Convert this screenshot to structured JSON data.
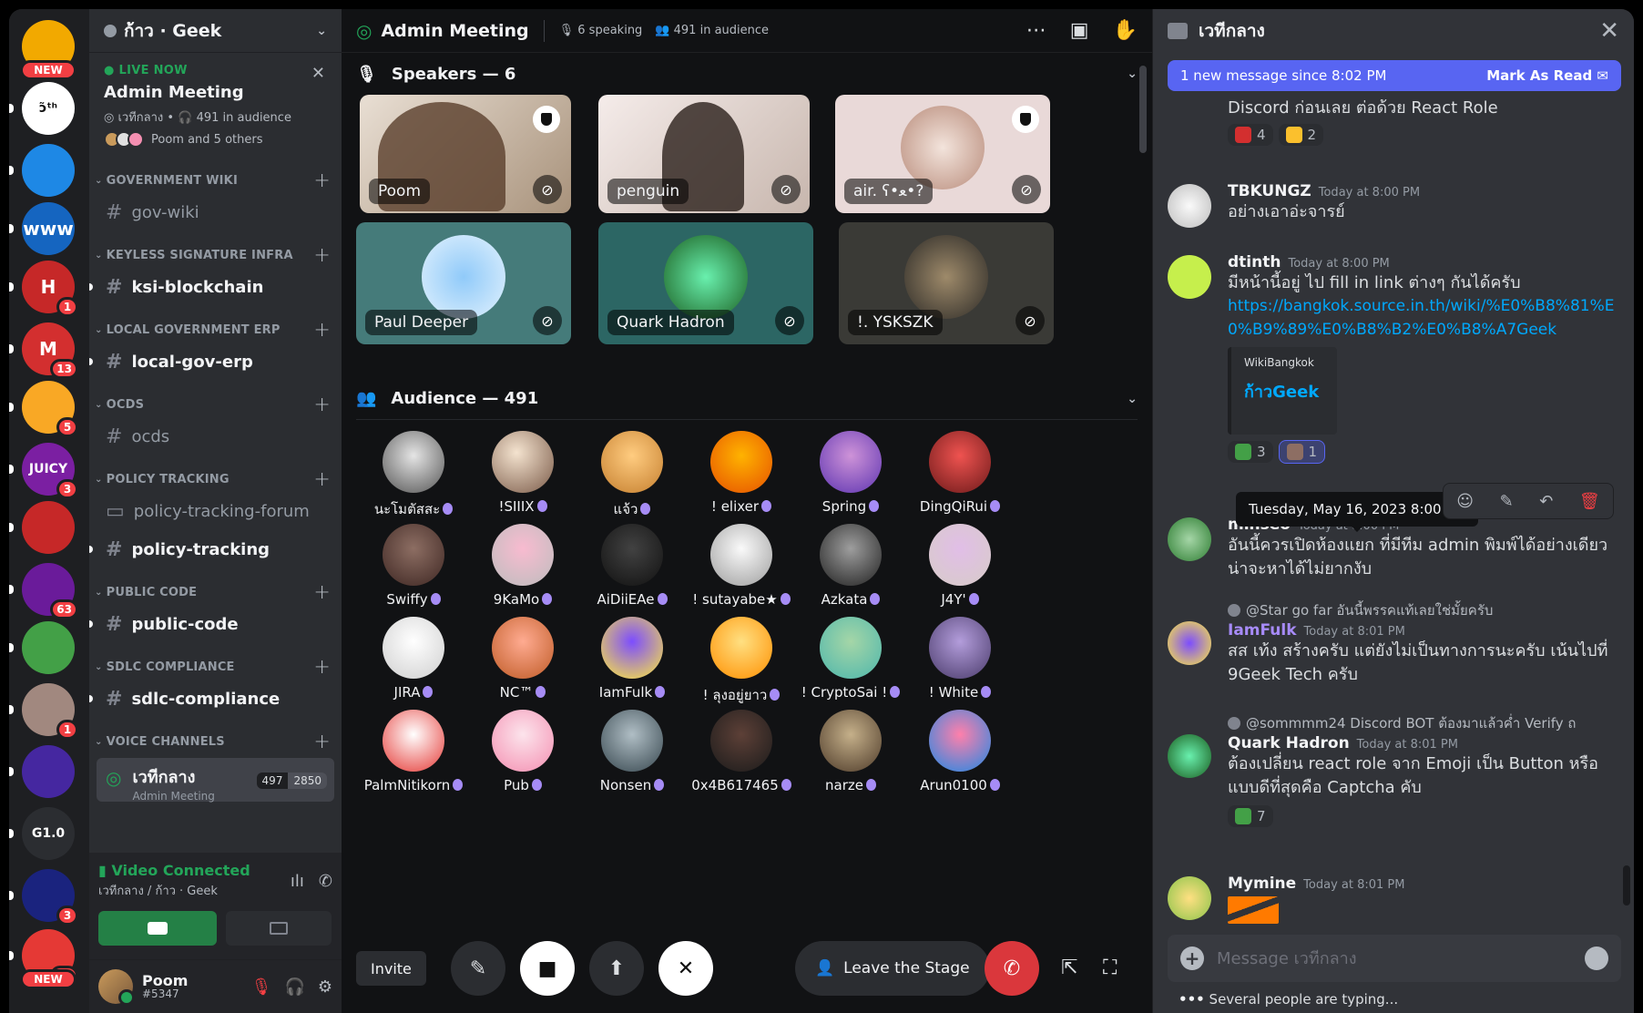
{
  "server": {
    "name": "ก้าว · Geek"
  },
  "live": {
    "label": "LIVE NOW",
    "title": "Admin Meeting",
    "channel": "เวทีกลาง",
    "audience": "491 in audience",
    "speakers": "Poom and 5 others"
  },
  "rail": {
    "new_label": "NEW",
    "items": [
      {
        "label": "",
        "badge": "",
        "new": true,
        "color": "#f2a900"
      },
      {
        "label": "ɔ̃ᵗʰ",
        "badge": "",
        "new": false,
        "color": "#ffffff"
      },
      {
        "label": "",
        "badge": "",
        "new": false,
        "color": "#1e88e5"
      },
      {
        "label": "www",
        "badge": "",
        "new": false,
        "color": "#1565c0"
      },
      {
        "label": "H",
        "badge": "1",
        "new": false,
        "color": "#c62828"
      },
      {
        "label": "M",
        "badge": "13",
        "new": false,
        "color": "#d32f2f"
      },
      {
        "label": "",
        "badge": "5",
        "new": false,
        "color": "#f9a825"
      },
      {
        "label": "JUICY",
        "badge": "3",
        "new": false,
        "color": "#7b1fa2"
      },
      {
        "label": "",
        "badge": "",
        "new": false,
        "color": "#c62828"
      },
      {
        "label": "",
        "badge": "63",
        "new": false,
        "color": "#6a1b9a"
      },
      {
        "label": "",
        "badge": "",
        "new": false,
        "color": "#43a047"
      },
      {
        "label": "",
        "badge": "1",
        "new": false,
        "color": "#a1887f"
      },
      {
        "label": "",
        "badge": "",
        "new": false,
        "color": "#4527a0"
      },
      {
        "label": "G1.0",
        "badge": "",
        "new": false,
        "color": "#2b2d31"
      },
      {
        "label": "",
        "badge": "3",
        "new": false,
        "color": "#1a237e"
      },
      {
        "label": "",
        "badge": "10",
        "new": true,
        "color": "#e53935"
      }
    ]
  },
  "sidebar": {
    "categories": [
      {
        "name": "GOVERNMENT WIKI",
        "channels": [
          {
            "name": "gov-wiki",
            "unread": false,
            "type": "text"
          }
        ]
      },
      {
        "name": "KEYLESS SIGNATURE INFRA",
        "channels": [
          {
            "name": "ksi-blockchain",
            "unread": true,
            "type": "text"
          }
        ]
      },
      {
        "name": "LOCAL GOVERNMENT ERP",
        "channels": [
          {
            "name": "local-gov-erp",
            "unread": true,
            "type": "text"
          }
        ]
      },
      {
        "name": "OCDS",
        "channels": [
          {
            "name": "ocds",
            "unread": false,
            "type": "text"
          }
        ]
      },
      {
        "name": "POLICY TRACKING",
        "channels": [
          {
            "name": "policy-tracking-forum",
            "unread": false,
            "type": "forum"
          },
          {
            "name": "policy-tracking",
            "unread": true,
            "type": "text"
          }
        ]
      },
      {
        "name": "PUBLIC CODE",
        "channels": [
          {
            "name": "public-code",
            "unread": true,
            "type": "text"
          }
        ]
      },
      {
        "name": "SDLC COMPLIANCE",
        "channels": [
          {
            "name": "sdlc-compliance",
            "unread": true,
            "type": "text"
          }
        ]
      },
      {
        "name": "VOICE CHANNELS",
        "channels": []
      }
    ],
    "voice_channel": {
      "name": "เวทีกลาง",
      "sub": "Admin Meeting",
      "count_a": "497",
      "count_b": "2850"
    }
  },
  "voice": {
    "status": "Video Connected",
    "path": "เวทีกลาง / ก้าว · Geek"
  },
  "user": {
    "name": "Poom",
    "tag": "#5347"
  },
  "stage": {
    "title": "Admin Meeting",
    "speaking": "6 speaking",
    "audience": "491 in audience",
    "speakers_header": "Speakers — 6",
    "audience_header": "Audience — 491",
    "speakers": [
      {
        "name": "Poom",
        "mod": true
      },
      {
        "name": "penguin",
        "mod": false
      },
      {
        "name": "air. ʕ•ﻌ•?",
        "mod": true
      },
      {
        "name": "Paul Deeper",
        "mod": false
      },
      {
        "name": "Quark Hadron",
        "mod": false
      },
      {
        "name": "!. YSKSZK",
        "mod": false
      }
    ],
    "audience_members": [
      {
        "name": "นะโมตัสสะ",
        "c": "g2"
      },
      {
        "name": "!SIIIX",
        "c": "g1"
      },
      {
        "name": "แจ้ว",
        "c": "g3"
      },
      {
        "name": "! elixer",
        "c": "g4"
      },
      {
        "name": "Spring",
        "c": "g5"
      },
      {
        "name": "DingQiRui",
        "c": "g6"
      },
      {
        "name": "Swiffy",
        "c": "g7"
      },
      {
        "name": "9KaMo",
        "c": "g8"
      },
      {
        "name": "AiDiiEAe",
        "c": "g9"
      },
      {
        "name": "! sutayabe★",
        "c": "g10"
      },
      {
        "name": "Azkata",
        "c": "g11"
      },
      {
        "name": "J4Y'",
        "c": "g12"
      },
      {
        "name": "JIRA",
        "c": "g13"
      },
      {
        "name": "NC™",
        "c": "g14"
      },
      {
        "name": "IamFulk",
        "c": "g15"
      },
      {
        "name": "! ลุงอยู่ยาว",
        "c": "g16"
      },
      {
        "name": "! CryptoSai !",
        "c": "g17"
      },
      {
        "name": "! White",
        "c": "g18"
      },
      {
        "name": "PalmNitikorn",
        "c": "g19"
      },
      {
        "name": "Pub",
        "c": "g20"
      },
      {
        "name": "Nonsen",
        "c": "g21"
      },
      {
        "name": "0x4B617465",
        "c": "g22"
      },
      {
        "name": "narze",
        "c": "g23"
      },
      {
        "name": "Arun0100",
        "c": "g24"
      }
    ],
    "invite_label": "Invite",
    "leave_label": "Leave the Stage"
  },
  "chat": {
    "title": "เวทีกลาง",
    "new_messages": "1 new message since 8:02 PM",
    "mark_read": "Mark As Read",
    "partial_text": "Discord ก่อนเลย ต่อด้วย React Role",
    "partial_reactions": [
      "4",
      "2"
    ],
    "messages": [
      {
        "author": "TBKUNGZ",
        "time": "Today at 8:00 PM",
        "text": "อย่างเอาอ่ะจารย์"
      },
      {
        "author": "dtinth",
        "time": "Today at 8:00 PM",
        "text": "มีหน้านี้อยู่ ไป fill in link ต่างๆ กันได้ครับ",
        "link": "https://bangkok.source.in.th/wiki/%E0%B8%81%E0%B9%89%E0%B8%B2%E0%B8%A7Geek",
        "embed_provider": "WikiBangkok",
        "embed_title": "ก้าวGeek",
        "reactions": [
          "3",
          "1"
        ]
      },
      {
        "author": "minseo",
        "time": "Today at 8:00 PM",
        "text": "อันนี้ควรเปิดห้องแยก ที่มีทีม admin พิมพ์ได้อย่างเดียว น่าจะหาได้ไม่ยากงับ"
      },
      {
        "author": "IamFulk",
        "time": "Today at 8:01 PM",
        "reply": "@Star go far อันนี้พรรคแท้เลยใช่มั้ยครับ",
        "text": "สส เท้ง สร้างครับ แต่ยังไม่เป็นทางการนะครับ เน้นไปที่ 9Geek Tech ครับ"
      },
      {
        "author": "Quark Hadron",
        "time": "Today at 8:01 PM",
        "reply": "@sommmm24 Discord BOT ต้องมาแล้วค่ำ Verify ถ",
        "text": "ต้องเปลี่ยน react role จาก Emoji เป็น Button หรือแบบดีที่สุดคือ Captcha คับ",
        "reactions": [
          "7"
        ]
      },
      {
        "author": "Mymine",
        "time": "Today at 8:01 PM",
        "text": ""
      }
    ],
    "tooltip": "Tuesday, May 16, 2023 8:00 PM",
    "composer_placeholder": "Message เวทีกลาง",
    "typing": "Several people are typing..."
  }
}
